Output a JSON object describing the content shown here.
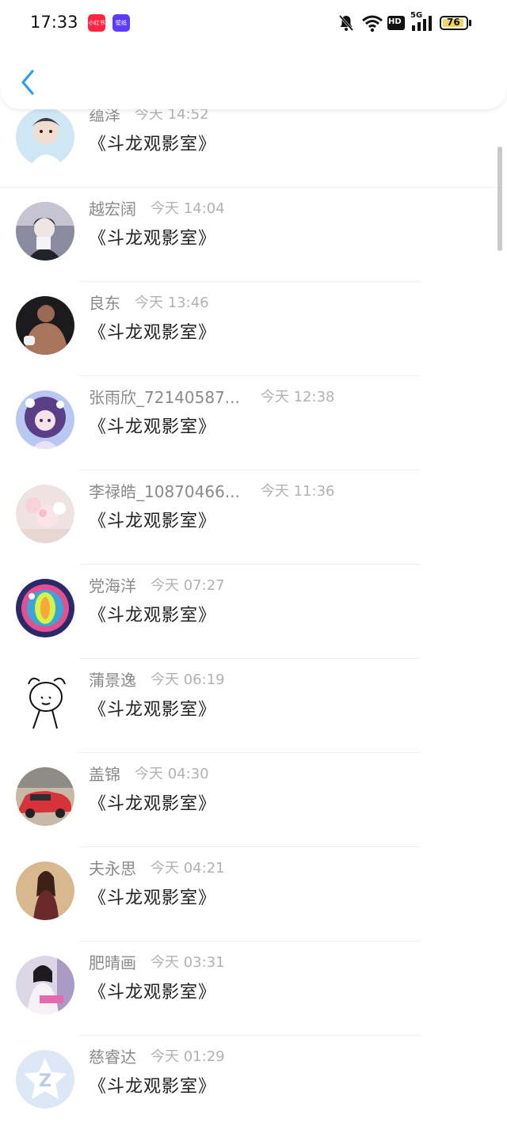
{
  "status_bar": {
    "time": "17:33",
    "apps": [
      "小红书",
      "壁纸"
    ],
    "battery": "76",
    "network": "5G",
    "hd_label": "HD",
    "colors": {
      "app1": "#ff2442",
      "app2": "#5b3cff",
      "battery_fill": "#f3d55b"
    }
  },
  "header": {
    "back_icon": "chevron-left-icon",
    "accent": "#2f9ee8"
  },
  "comments": [
    {
      "name": "蕴泽",
      "time": "今天 14:52",
      "message": "《斗龙观影室》"
    },
    {
      "name": "越宏阔",
      "time": "今天 14:04",
      "message": "《斗龙观影室》"
    },
    {
      "name": "良东",
      "time": "今天 13:46",
      "message": "《斗龙观影室》"
    },
    {
      "name": "张雨欣_72140587...",
      "time": "今天 12:38",
      "message": "《斗龙观影室》"
    },
    {
      "name": "李禄皓_10870466...",
      "time": "今天 11:36",
      "message": "《斗龙观影室》"
    },
    {
      "name": "党海洋",
      "time": "今天 07:27",
      "message": "《斗龙观影室》"
    },
    {
      "name": "蒲景逸",
      "time": "今天 06:19",
      "message": "《斗龙观影室》"
    },
    {
      "name": "盖锦",
      "time": "今天 04:30",
      "message": "《斗龙观影室》"
    },
    {
      "name": "夫永思",
      "time": "今天 04:21",
      "message": "《斗龙观影室》"
    },
    {
      "name": "肥晴画",
      "time": "今天 03:31",
      "message": "《斗龙观影室》"
    },
    {
      "name": "慈睿达",
      "time": "今天 01:29",
      "message": "《斗龙观影室》"
    }
  ]
}
